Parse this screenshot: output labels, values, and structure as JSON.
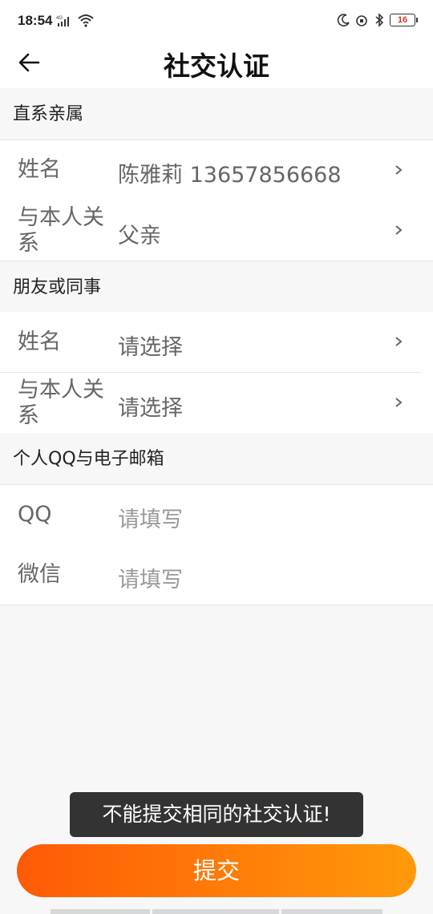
{
  "status_bar": {
    "time": "18:54",
    "network": "4G",
    "battery": "16"
  },
  "header": {
    "title": "社交认证"
  },
  "sections": {
    "family": {
      "heading": "直系亲属",
      "name_label": "姓名",
      "name_value": "陈雅莉  13657856668",
      "relation_label": "与本人关系",
      "relation_value": "父亲"
    },
    "friend": {
      "heading": "朋友或同事",
      "name_label": "姓名",
      "name_placeholder": "请选择",
      "relation_label": "与本人关系",
      "relation_placeholder": "请选择"
    },
    "contact": {
      "heading": "个人QQ与电子邮箱",
      "qq_label": "QQ",
      "qq_placeholder": "请填写",
      "wechat_label": "微信",
      "wechat_placeholder": "请填写"
    }
  },
  "toast": "不能提交相同的社交认证!",
  "submit_label": "提交",
  "colors": {
    "accent_start": "#ff5a06",
    "accent_end": "#ff9a0a",
    "toast_bg": "#333333"
  }
}
